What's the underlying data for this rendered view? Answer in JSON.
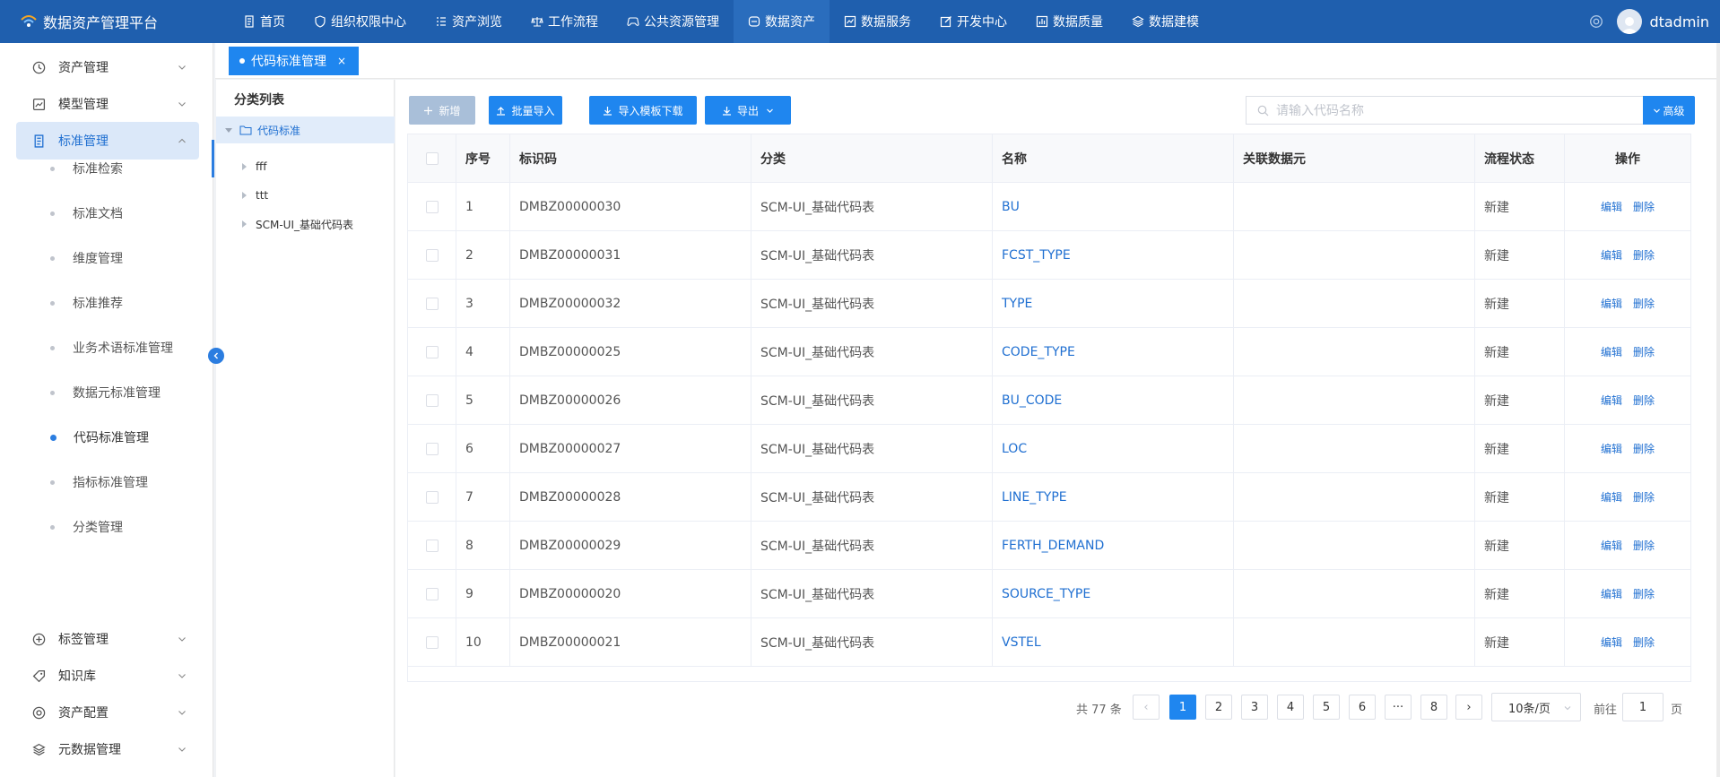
{
  "app": {
    "title": "数据资产管理平台",
    "username": "dtadmin"
  },
  "nav": [
    {
      "label": "首页",
      "icon": "doc-icon"
    },
    {
      "label": "组织权限中心",
      "icon": "shield-icon"
    },
    {
      "label": "资产浏览",
      "icon": "list-icon"
    },
    {
      "label": "工作流程",
      "icon": "scale-icon"
    },
    {
      "label": "公共资源管理",
      "icon": "gamepad-icon"
    },
    {
      "label": "数据资产",
      "icon": "database-icon",
      "active": true
    },
    {
      "label": "数据服务",
      "icon": "chart-icon"
    },
    {
      "label": "开发中心",
      "icon": "edit-icon"
    },
    {
      "label": "数据质量",
      "icon": "bar-chart-icon"
    },
    {
      "label": "数据建模",
      "icon": "layers-icon"
    }
  ],
  "sidebar": {
    "menus": [
      {
        "label": "资产管理",
        "icon": "clock-icon"
      },
      {
        "label": "模型管理",
        "icon": "chart-box-icon"
      },
      {
        "label": "标准管理",
        "icon": "doc-icon",
        "open": true
      },
      {
        "label": "标签管理",
        "icon": "plus-circle-icon"
      },
      {
        "label": "知识库",
        "icon": "tag-icon"
      },
      {
        "label": "资产配置",
        "icon": "target-icon"
      },
      {
        "label": "元数据管理",
        "icon": "layers-icon"
      }
    ],
    "sub_items": [
      {
        "label": "标准检索"
      },
      {
        "label": "标准文档"
      },
      {
        "label": "维度管理"
      },
      {
        "label": "标准推荐"
      },
      {
        "label": "业务术语标准管理"
      },
      {
        "label": "数据元标准管理"
      },
      {
        "label": "代码标准管理",
        "active": true
      },
      {
        "label": "指标标准管理"
      },
      {
        "label": "分类管理"
      }
    ]
  },
  "tabs": [
    {
      "label": "代码标准管理",
      "close": "×"
    }
  ],
  "tree": {
    "title": "分类列表",
    "root": "代码标准",
    "children": [
      "fff",
      "ttt",
      "SCM-UI_基础代码表"
    ]
  },
  "toolbar": {
    "add": "新增",
    "batch_import": "批量导入",
    "template_download": "导入模板下载",
    "export": "导出",
    "search_placeholder": "请输入代码名称",
    "advanced": "高级"
  },
  "table": {
    "headers": [
      "序号",
      "标识码",
      "分类",
      "名称",
      "关联数据元",
      "流程状态",
      "操作"
    ],
    "edit_label": "编辑",
    "delete_label": "删除",
    "rows": [
      {
        "no": "1",
        "code": "DMBZ00000030",
        "category": "SCM-UI_基础代码表",
        "name": "BU",
        "linked": "",
        "status": "新建"
      },
      {
        "no": "2",
        "code": "DMBZ00000031",
        "category": "SCM-UI_基础代码表",
        "name": "FCST_TYPE",
        "linked": "",
        "status": "新建"
      },
      {
        "no": "3",
        "code": "DMBZ00000032",
        "category": "SCM-UI_基础代码表",
        "name": "TYPE",
        "linked": "",
        "status": "新建"
      },
      {
        "no": "4",
        "code": "DMBZ00000025",
        "category": "SCM-UI_基础代码表",
        "name": "CODE_TYPE",
        "linked": "",
        "status": "新建"
      },
      {
        "no": "5",
        "code": "DMBZ00000026",
        "category": "SCM-UI_基础代码表",
        "name": "BU_CODE",
        "linked": "",
        "status": "新建"
      },
      {
        "no": "6",
        "code": "DMBZ00000027",
        "category": "SCM-UI_基础代码表",
        "name": "LOC",
        "linked": "",
        "status": "新建"
      },
      {
        "no": "7",
        "code": "DMBZ00000028",
        "category": "SCM-UI_基础代码表",
        "name": "LINE_TYPE",
        "linked": "",
        "status": "新建"
      },
      {
        "no": "8",
        "code": "DMBZ00000029",
        "category": "SCM-UI_基础代码表",
        "name": "FERTH_DEMAND",
        "linked": "",
        "status": "新建"
      },
      {
        "no": "9",
        "code": "DMBZ00000020",
        "category": "SCM-UI_基础代码表",
        "name": "SOURCE_TYPE",
        "linked": "",
        "status": "新建"
      },
      {
        "no": "10",
        "code": "DMBZ00000021",
        "category": "SCM-UI_基础代码表",
        "name": "VSTEL",
        "linked": "",
        "status": "新建"
      }
    ]
  },
  "pagination": {
    "total": "共 77 条",
    "prev": "‹",
    "next": "›",
    "pages": [
      "1",
      "2",
      "3",
      "4",
      "5",
      "6",
      "···",
      "8"
    ],
    "current": "1",
    "page_size": "10条/页",
    "goto_label": "前往",
    "goto_value": "1",
    "goto_unit": "页"
  },
  "colors": {
    "topbar": "#1f5fae",
    "primary": "#1f86ef",
    "link": "#1f6fd1"
  }
}
